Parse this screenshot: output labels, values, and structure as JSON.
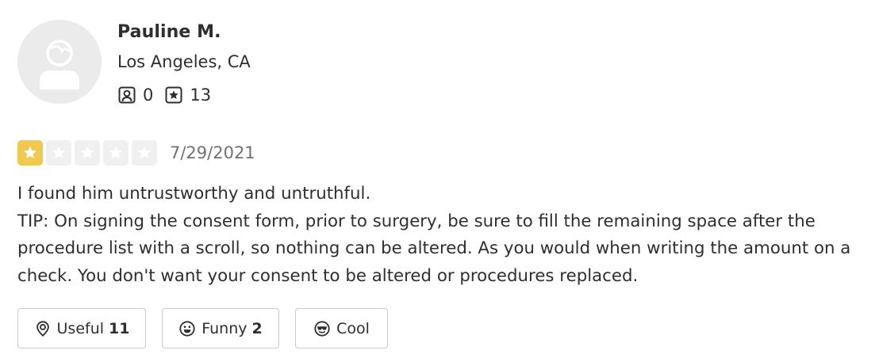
{
  "user": {
    "name": "Pauline M.",
    "location": "Los Angeles, CA",
    "friends_count": "0",
    "reviews_count": "13"
  },
  "review": {
    "rating": 1,
    "max_rating": 5,
    "date": "7/29/2021",
    "line1": "I found him untrustworthy and untruthful.",
    "line2": "TIP: On signing the consent form, prior to surgery, be sure to fill the remaining space after the procedure list with a scroll, so nothing can be altered. As you would when writing the amount on a check. You don't want your consent to be altered or procedures replaced."
  },
  "reactions": {
    "useful": {
      "label": "Useful",
      "count": "11",
      "icon": "lightbulb-icon"
    },
    "funny": {
      "label": "Funny",
      "count": "2",
      "icon": "smiley-icon"
    },
    "cool": {
      "label": "Cool",
      "icon": "sunglasses-icon"
    }
  },
  "colors": {
    "star_on": "#f2c94c",
    "star_off": "#f0f0f0",
    "text": "#2d2e2f",
    "muted": "#6e7072",
    "border": "#c9cacb"
  }
}
